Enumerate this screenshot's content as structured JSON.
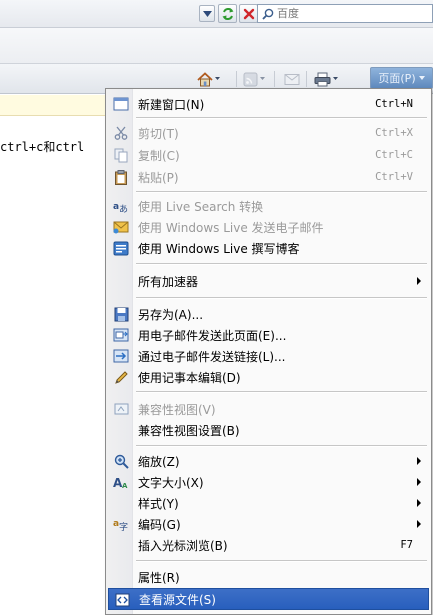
{
  "browser": {
    "search_placeholder": "百度",
    "page_menu_label": "页面(P)",
    "page_partial_text": "ctrl+c和ctrl"
  },
  "menu": {
    "items": [
      {
        "label": "新建窗口(N)",
        "shortcut": "Ctrl+N",
        "icon": "new-window-icon",
        "disabled": false
      },
      {
        "label": "剪切(T)",
        "shortcut": "Ctrl+X",
        "icon": "scissors-icon",
        "disabled": true
      },
      {
        "label": "复制(C)",
        "shortcut": "Ctrl+C",
        "icon": "copy-icon",
        "disabled": true
      },
      {
        "label": "粘贴(P)",
        "shortcut": "Ctrl+V",
        "icon": "clipboard-icon",
        "disabled": true
      },
      {
        "label": "使用 Live Search 转换",
        "icon": "translate-icon",
        "disabled": true
      },
      {
        "label": "使用 Windows Live 发送电子邮件",
        "icon": "mail-icon",
        "disabled": true
      },
      {
        "label": "使用 Windows Live 撰写博客",
        "icon": "blog-icon",
        "disabled": false
      },
      {
        "label": "所有加速器",
        "icon": "",
        "disabled": false,
        "submenu": true
      },
      {
        "label": "另存为(A)...",
        "icon": "save-icon",
        "disabled": false
      },
      {
        "label": "用电子邮件发送此页面(E)...",
        "icon": "email-page-icon",
        "disabled": false
      },
      {
        "label": "通过电子邮件发送链接(L)...",
        "icon": "email-link-icon",
        "disabled": false
      },
      {
        "label": "使用记事本编辑(D)",
        "icon": "pencil-icon",
        "disabled": false
      },
      {
        "label": "兼容性视图(V)",
        "icon": "compat-view-icon",
        "disabled": true
      },
      {
        "label": "兼容性视图设置(B)",
        "icon": "",
        "disabled": false
      },
      {
        "label": "缩放(Z)",
        "icon": "zoom-icon",
        "disabled": false,
        "submenu": true
      },
      {
        "label": "文字大小(X)",
        "icon": "text-size-icon",
        "disabled": false,
        "submenu": true
      },
      {
        "label": "样式(Y)",
        "icon": "",
        "disabled": false,
        "submenu": true
      },
      {
        "label": "编码(G)",
        "icon": "encoding-icon",
        "disabled": false,
        "submenu": true
      },
      {
        "label": "插入光标浏览(B)",
        "shortcut": "F7",
        "icon": "",
        "disabled": false
      },
      {
        "label": "属性(R)",
        "icon": "",
        "disabled": false
      },
      {
        "label": "查看源文件(S)",
        "icon": "view-source-icon",
        "disabled": false,
        "selected": true
      }
    ]
  }
}
